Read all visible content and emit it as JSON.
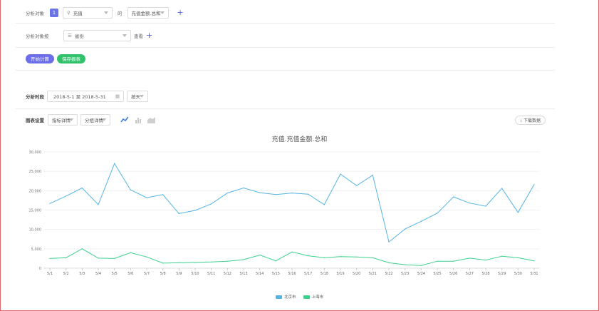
{
  "analysis_target": {
    "label": "分析对象",
    "badge": "1",
    "event": "充值",
    "connector": "的",
    "metric": "充值金额.总和"
  },
  "group_by": {
    "label": "分析对象按",
    "field": "省份",
    "suffix": "查看"
  },
  "actions": {
    "start_label": "开始计算",
    "save_label": "保存报表"
  },
  "period": {
    "label": "分析时段",
    "range": "2018-5-1 至 2018-5-31",
    "granularity": "按天"
  },
  "chart_settings": {
    "label": "图表设置",
    "metric_detail": "指标详情",
    "group_detail": "分组详情",
    "download_label": "下载数据"
  },
  "chart_data": {
    "type": "line",
    "title": "充值.充值金额.总和",
    "categories": [
      "5/1",
      "5/2",
      "5/3",
      "5/4",
      "5/5",
      "5/6",
      "5/7",
      "5/8",
      "5/9",
      "5/10",
      "5/11",
      "5/12",
      "5/13",
      "5/14",
      "5/15",
      "5/16",
      "5/17",
      "5/18",
      "5/19",
      "5/20",
      "5/21",
      "5/22",
      "5/23",
      "5/24",
      "5/25",
      "5/26",
      "5/27",
      "5/28",
      "5/29",
      "5/30",
      "5/31"
    ],
    "yticks": [
      "0",
      "5,000",
      "10,000",
      "15,000",
      "20,000",
      "25,000",
      "30,000"
    ],
    "ylim": [
      0,
      30000
    ],
    "series": [
      {
        "name": "北京市",
        "color": "#55b4e3",
        "values": [
          16700,
          18600,
          20700,
          16400,
          27000,
          20200,
          18200,
          19000,
          14100,
          14900,
          16600,
          19400,
          20700,
          19500,
          19000,
          19400,
          19100,
          16400,
          24300,
          21300,
          24000,
          6800,
          10100,
          12100,
          14200,
          18400,
          16800,
          16000,
          20600,
          14400,
          21600
        ]
      },
      {
        "name": "上海市",
        "color": "#3dd08c",
        "values": [
          2500,
          2700,
          5000,
          2600,
          2500,
          4000,
          2900,
          1300,
          1400,
          1500,
          1600,
          1800,
          2200,
          3400,
          1900,
          4200,
          3200,
          2700,
          3000,
          2900,
          2700,
          1400,
          900,
          700,
          1800,
          1800,
          2600,
          2100,
          3100,
          2700,
          1900
        ]
      }
    ]
  },
  "icons": {
    "event_icon": "event-icon",
    "group_icon": "list-icon",
    "calendar_icon": "calendar-icon",
    "line_chart_icon": "line-chart-icon",
    "bar_chart_icon": "bar-chart-icon",
    "area_chart_icon": "area-chart-icon",
    "download_icon": "download-icon"
  }
}
